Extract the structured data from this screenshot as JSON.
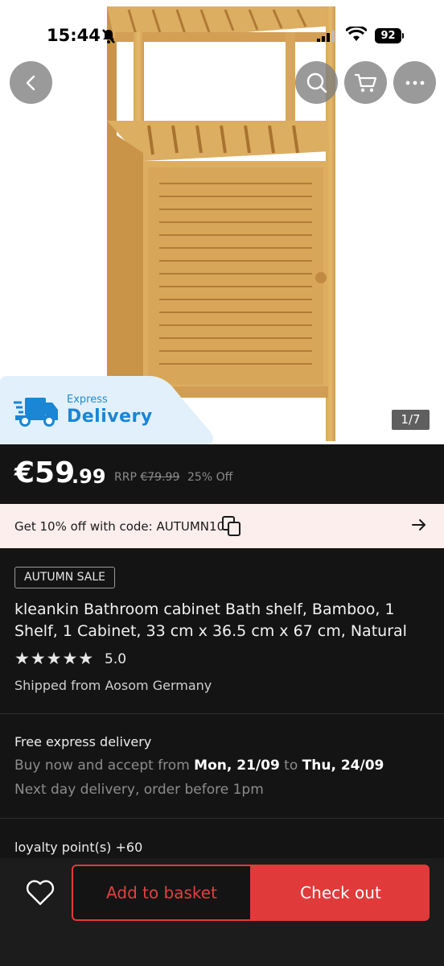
{
  "status_bar": {
    "time": "15:44",
    "battery": "92"
  },
  "gallery": {
    "pager": "1/7"
  },
  "badge": {
    "line1": "Express",
    "line2": "Delivery"
  },
  "price": {
    "currency_int": "€59",
    "cents": ".99",
    "rrp_label": "RRP",
    "rrp_value": "€79.99",
    "discount": "25% Off"
  },
  "promo": {
    "text": "Get 10% off with code: AUTUMN10"
  },
  "product": {
    "tag": "AUTUMN SALE",
    "title": "kleankin Bathroom cabinet Bath shelf, Bamboo, 1 Shelf, 1 Cabinet, 33 cm x 36.5 cm x 67 cm, Natural",
    "stars": "★★★★★",
    "rating": "5.0",
    "shipped_from": "Shipped from Aosom Germany"
  },
  "delivery": {
    "title": "Free express delivery",
    "buy_prefix": "Buy now and accept from ",
    "date_from": "Mon, 21/09",
    "to_word": " to ",
    "date_to": "Thu, 24/09",
    "next_day": "Next day delivery, order before 1pm"
  },
  "loyalty": {
    "text": "loyalty point(s)  +60"
  },
  "actions": {
    "add_to_basket": "Add to basket",
    "check_out": "Check out"
  },
  "icons": [
    "back-icon",
    "search-icon",
    "cart-icon",
    "more-icon",
    "truck-icon",
    "copy-icon",
    "arrow-right-icon",
    "heart-icon"
  ],
  "colors": {
    "accent": "#e13a3a",
    "express_blue": "#1a86d4",
    "promo_bg": "#fdeeee"
  }
}
